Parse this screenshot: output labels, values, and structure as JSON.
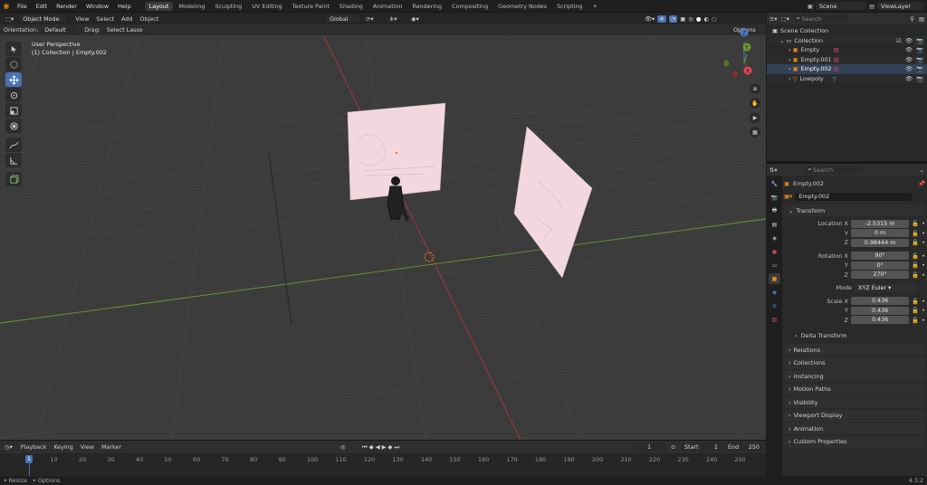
{
  "top": {
    "menus": [
      "File",
      "Edit",
      "Render",
      "Window",
      "Help"
    ],
    "workspaces": [
      "Layout",
      "Modeling",
      "Sculpting",
      "UV Editing",
      "Texture Paint",
      "Shading",
      "Animation",
      "Rendering",
      "Compositing",
      "Geometry Nodes",
      "Scripting"
    ],
    "add_tab": "+",
    "scene": "Scene",
    "view_layer": "ViewLayer"
  },
  "viewport": {
    "mode": "Object Mode",
    "menus": [
      "View",
      "Select",
      "Add",
      "Object"
    ],
    "transform_orientation": "Global",
    "orientation_label": "Orientation:",
    "orientation_value": "Default",
    "drag_label": "Drag:",
    "drag_value": "Select Lasso",
    "options_label": "Options",
    "overlay_line1": "User Perspective",
    "overlay_line2": "(1) Collection | Empty.002",
    "gizmo_z": "Z",
    "gizmo_y": "Y",
    "gizmo_x": "X"
  },
  "outliner": {
    "search_placeholder": "Search",
    "root": "Scene Collection",
    "collection": "Collection",
    "items": [
      "Empty",
      "Empty.001",
      "Empty.002",
      "Lowpoly"
    ]
  },
  "properties": {
    "search_placeholder": "Search",
    "object_name": "Empty.002",
    "data_name": "Empty.002",
    "transform_title": "Transform",
    "location_label": "Location X",
    "location": [
      "-2.5315 m",
      "0 m",
      "0.98444 m"
    ],
    "rotation_label": "Rotation X",
    "rotation": [
      "90°",
      "0°",
      "270°"
    ],
    "axis_y": "Y",
    "axis_z": "Z",
    "mode_label": "Mode",
    "mode_value": "XYZ Euler",
    "scale_label": "Scale X",
    "scale": [
      "0.436",
      "0.436",
      "0.436"
    ],
    "delta": "Delta Transform",
    "panels": [
      "Relations",
      "Collections",
      "Instancing",
      "Motion Paths",
      "Visibility",
      "Viewport Display",
      "Animation",
      "Custom Properties"
    ]
  },
  "timeline": {
    "menus": [
      "Playback",
      "Keying",
      "View",
      "Marker"
    ],
    "current_frame": "1",
    "start_label": "Start",
    "start": "1",
    "end_label": "End",
    "end": "250",
    "ticks": [
      "1",
      "10",
      "20",
      "30",
      "40",
      "50",
      "60",
      "70",
      "80",
      "90",
      "100",
      "110",
      "120",
      "130",
      "140",
      "150",
      "160",
      "170",
      "180",
      "190",
      "200",
      "210",
      "220",
      "230",
      "240",
      "250"
    ]
  },
  "status": {
    "resize": "Resize",
    "options": "Options",
    "version": "4.3.2"
  },
  "colors": {
    "accent": "#4772b3",
    "x_axis": "#a83535",
    "y_axis": "#6b9a32",
    "plane": "#f2d8de",
    "origin": "#e28a1d"
  }
}
